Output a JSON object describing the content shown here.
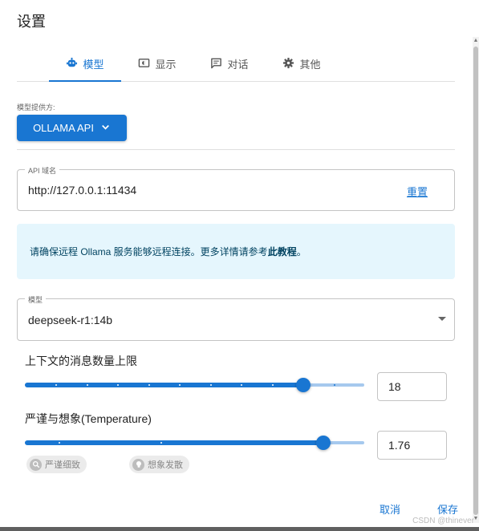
{
  "dialog": {
    "title": "设置"
  },
  "tabs": [
    {
      "label": "模型",
      "icon": "robot-icon",
      "active": true
    },
    {
      "label": "显示",
      "icon": "display-icon",
      "active": false
    },
    {
      "label": "对话",
      "icon": "chat-icon",
      "active": false
    },
    {
      "label": "其他",
      "icon": "gear-icon",
      "active": false
    }
  ],
  "provider": {
    "label": "模型提供方:",
    "value": "OLLAMA API"
  },
  "api_host": {
    "legend": "API 域名",
    "value": "http://127.0.0.1:11434",
    "reset_label": "重置"
  },
  "notice": {
    "text": "请确保远程 Ollama 服务能够远程连接。更多详情请参考",
    "link": "此教程",
    "suffix": "。"
  },
  "model_select": {
    "legend": "模型",
    "value": "deepseek-r1:14b"
  },
  "context_limit": {
    "label": "上下文的消息数量上限",
    "value": "18",
    "level": 0.82
  },
  "temperature": {
    "label": "严谨与想象(Temperature)",
    "value": "1.76",
    "level": 0.88
  },
  "chips": {
    "rigorous": "严谨细致",
    "imaginative": "想象发散"
  },
  "actions": {
    "cancel": "取消",
    "save": "保存"
  },
  "watermark": "CSDN @thinever",
  "colors": {
    "accent": "#1976d2",
    "info_bg": "#e5f6fd",
    "info_text": "#014361"
  }
}
